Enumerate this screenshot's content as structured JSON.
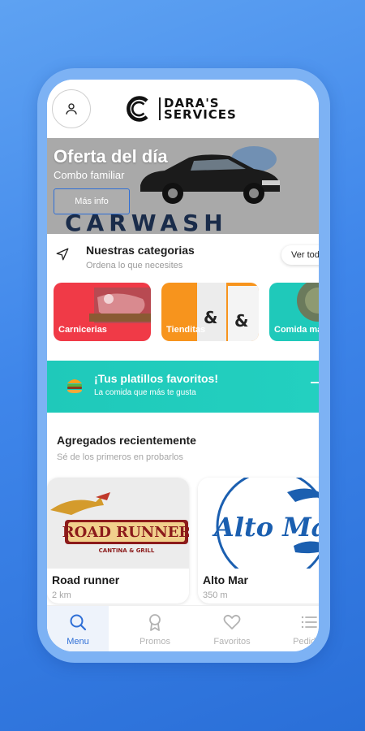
{
  "app": {
    "logo_line1": "DARA'S",
    "logo_line2": "SERVICES"
  },
  "banner": {
    "title": "Oferta del día",
    "subtitle": "Combo familiar",
    "button_label": "Más info",
    "image_text": "CARWASH",
    "slide_count": 2,
    "active_slide": 1
  },
  "categories": {
    "title": "Nuestras categorias",
    "subtitle": "Ordena lo que necesites",
    "see_all_label": "Ver todo",
    "items": [
      {
        "label": "Carnicerias",
        "color": "#f03a47"
      },
      {
        "label": "Tienditas",
        "color": "#f7941d"
      },
      {
        "label": "Comida mar",
        "color": "#1fc9ba"
      }
    ]
  },
  "favorites_banner": {
    "title": "¡Tus platillos favoritos!",
    "subtitle": "La comida que más te gusta",
    "color": "#1fc9ba"
  },
  "recent": {
    "title": "Agregados recientemente",
    "subtitle": "Sé de los primeros en probarlos",
    "items": [
      {
        "name": "Road runner",
        "distance": "2 km",
        "logo_text": "ROAD RUNNER",
        "logo_sub": "CANTINA & GRILL"
      },
      {
        "name": "Alto Mar",
        "distance": "350 m",
        "logo_text": "Alto Mar"
      }
    ]
  },
  "bottom_nav": {
    "items": [
      {
        "label": "Menu",
        "icon": "search-icon",
        "active": true
      },
      {
        "label": "Promos",
        "icon": "badge-icon",
        "active": false
      },
      {
        "label": "Favoritos",
        "icon": "heart-icon",
        "active": false
      },
      {
        "label": "Pedidos",
        "icon": "list-icon",
        "active": false
      }
    ]
  },
  "colors": {
    "accent": "#2f6fd6",
    "teal": "#1fc9ba",
    "background": "#4a8de8"
  }
}
